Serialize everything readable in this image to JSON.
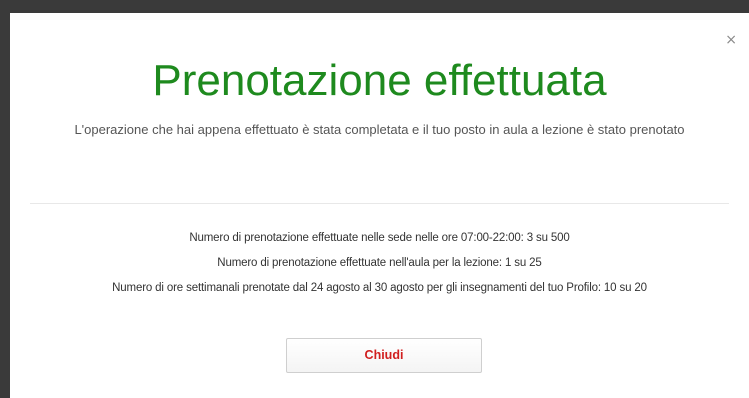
{
  "dialog": {
    "close_icon": "×",
    "title": "Prenotazione effettuata",
    "subtitle": "L'operazione che hai appena effettuato è stata completata e il tuo posto in aula a lezione è stato prenotato",
    "stats": [
      "Numero di prenotazione effettuate nelle sede nelle ore 07:00-22:00: 3 su 500",
      "Numero di prenotazione effettuate nell'aula per la lezione: 1 su 25",
      "Numero di ore settimanali prenotate dal 24 agosto al 30 agosto per gli insegnamenti del tuo Profilo: 10 su 20"
    ],
    "close_button_label": "Chiudi"
  },
  "colors": {
    "title": "#1e8a1e",
    "close_button_text": "#d11f1f",
    "backdrop": "#3a3a3a"
  }
}
